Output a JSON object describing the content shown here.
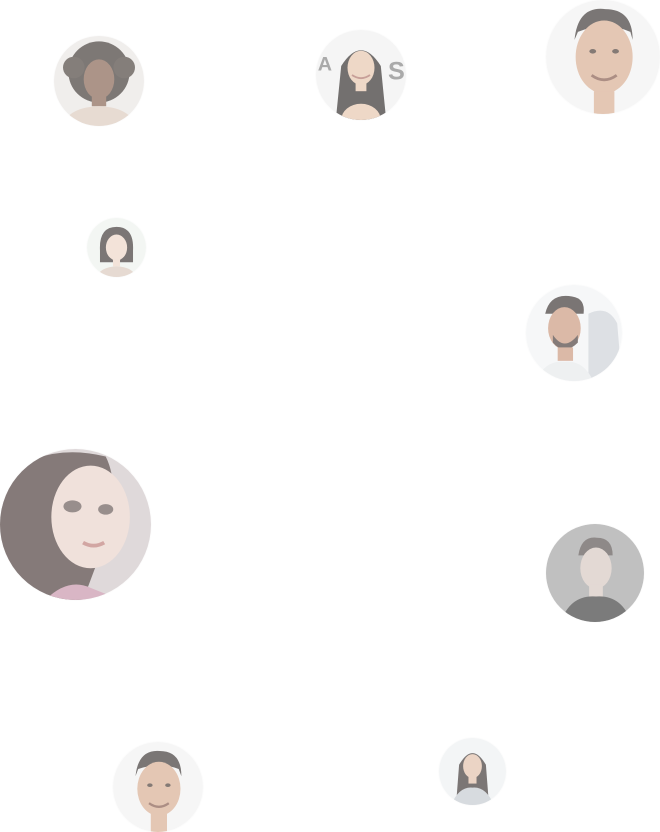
{
  "page": {
    "background": "#ffffff",
    "avatar_opacity": 0.62
  },
  "avatars": [
    {
      "id": "avatar-1",
      "hair": "curly-dark",
      "bg": "#e9e6e3"
    },
    {
      "id": "avatar-2",
      "hair": "long-dark",
      "bg": "#ededed"
    },
    {
      "id": "avatar-3",
      "hair": "short-dark",
      "bg": "#f3f3f3"
    },
    {
      "id": "avatar-4",
      "hair": "bob-dark",
      "bg": "#eef3ef"
    },
    {
      "id": "avatar-5",
      "hair": "short-dark",
      "bg": "#f2f4f6"
    },
    {
      "id": "avatar-6",
      "hair": "long-dark",
      "bg": "#cfc4c6"
    },
    {
      "id": "avatar-7",
      "hair": "short-dark",
      "bg": "#9a9a9a"
    },
    {
      "id": "avatar-8",
      "hair": "short-dark",
      "bg": "#f3f3f3"
    },
    {
      "id": "avatar-9",
      "hair": "long-dark",
      "bg": "#eceff1"
    }
  ]
}
